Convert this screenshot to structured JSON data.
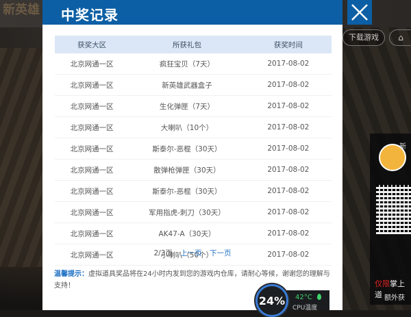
{
  "background": {
    "logo_text": "新英雄",
    "download_label": "下载游戏",
    "home_icon": "home-icon",
    "side_title": "新",
    "side_red": "仅限",
    "side_white": "掌上道",
    "side_sub": "额外获"
  },
  "modal": {
    "title": "中奖记录",
    "columns": [
      "获奖大区",
      "所获礼包",
      "获奖时间"
    ],
    "rows": [
      [
        "北京网通一区",
        "疯狂宝贝（7天）",
        "2017-08-02"
      ],
      [
        "北京网通一区",
        "新英雄武器盒子",
        "2017-08-02"
      ],
      [
        "北京网通一区",
        "生化弹匣（7天）",
        "2017-08-02"
      ],
      [
        "北京网通一区",
        "大喇叭（10个）",
        "2017-08-02"
      ],
      [
        "北京网通一区",
        "斯泰尔-恶棍（30天）",
        "2017-08-02"
      ],
      [
        "北京网通一区",
        "散弹枪弹匣（30天）",
        "2017-08-02"
      ],
      [
        "北京网通一区",
        "斯泰尔-恶棍（30天）",
        "2017-08-02"
      ],
      [
        "北京网通一区",
        "军用指虎-刺刀（30天）",
        "2017-08-02"
      ],
      [
        "北京网通一区",
        "AK47-A（30天）",
        "2017-08-02"
      ],
      [
        "北京网通一区",
        "小喇叭（50个）",
        "2017-08-02"
      ]
    ],
    "pager": {
      "current": "2/3页",
      "prev": "上一页",
      "next": "下一页"
    },
    "tip_label": "温馨提示：",
    "tip_text": "虚拟道具奖品将在24小时内发到您的游戏内仓库，请耐心等候，谢谢您的理解与支持！"
  },
  "cpu_widget": {
    "usage": "24%",
    "temp": "42°C",
    "label": "CPU温度"
  },
  "colors": {
    "header_blue": "#0c5fa4",
    "link_blue": "#1e6fc4",
    "table_header_bg": "#dbe7f6",
    "temp_green": "#3fd46c"
  }
}
